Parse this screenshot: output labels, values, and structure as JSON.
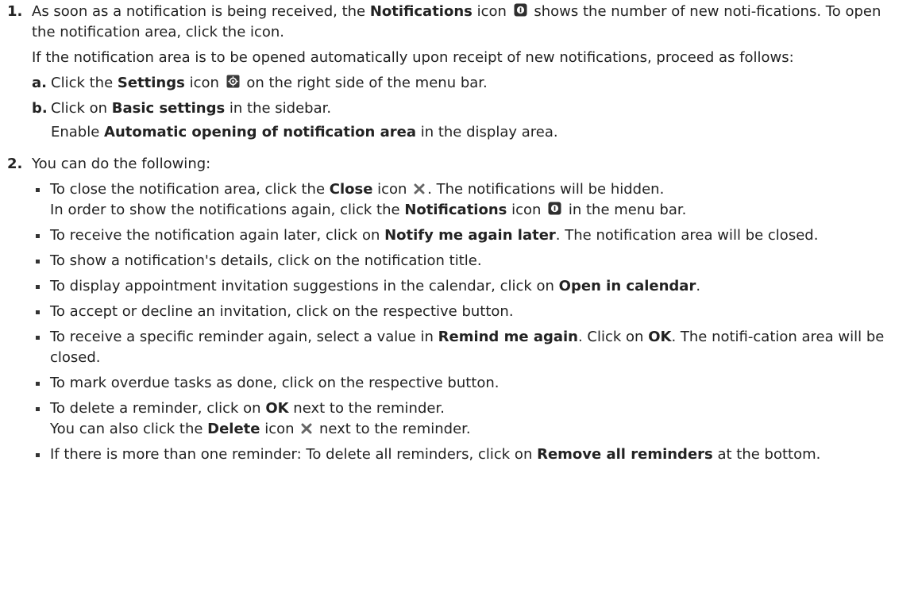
{
  "steps": [
    {
      "num": "1.",
      "p1": [
        "As soon as a notification is being received, the ",
        "Notifications",
        " icon ",
        " shows the number of new noti-fications. To open the notification area, click the icon."
      ],
      "p2": "If the notification area is to be opened automatically upon receipt of new notifications, proceed as follows:",
      "subs": [
        {
          "letter": "a.",
          "parts": [
            "Click the ",
            "Settings",
            " icon ",
            " on the right side of the menu bar."
          ]
        },
        {
          "letter": "b.",
          "parts": [
            "Click on ",
            "Basic settings",
            " in the sidebar."
          ],
          "cont": [
            "Enable ",
            "Automatic opening of notification area",
            " in the display area."
          ]
        }
      ]
    },
    {
      "num": "2.",
      "intro": "You can do the following:",
      "bullets": [
        {
          "l1": [
            "To close the notification area, click the ",
            "Close",
            " icon ",
            ". The notifications will be hidden."
          ],
          "l2": [
            "In order to show the notifications again, click the ",
            "Notifications",
            " icon ",
            " in the menu bar."
          ]
        },
        {
          "parts": [
            "To receive the notification again later, click on ",
            "Notify me again later",
            ". The notification area will be closed."
          ]
        },
        {
          "text": "To show a notification's details, click on the notification title."
        },
        {
          "parts": [
            "To display appointment invitation suggestions in the calendar, click on ",
            "Open in calendar",
            "."
          ]
        },
        {
          "text": "To accept or decline an invitation, click on the respective button."
        },
        {
          "parts": [
            "To receive a specific reminder again, select a value in ",
            "Remind me again",
            ". Click on ",
            "OK",
            ". The notifi-cation area will be closed."
          ]
        },
        {
          "text": "To mark overdue tasks as done, click on the respective button."
        },
        {
          "l1": [
            "To delete a reminder, click on ",
            "OK",
            " next to the reminder."
          ],
          "l2": [
            "You can also click the ",
            "Delete",
            " icon ",
            " next to the reminder."
          ]
        },
        {
          "parts": [
            "If there is more than one reminder: To delete all reminders, click on ",
            "Remove all reminders",
            " at the bottom."
          ]
        }
      ]
    }
  ],
  "icons": {
    "notifications": "notification-badge-icon",
    "settings": "settings-gear-icon",
    "close": "close-x-icon",
    "delete": "delete-x-icon"
  }
}
